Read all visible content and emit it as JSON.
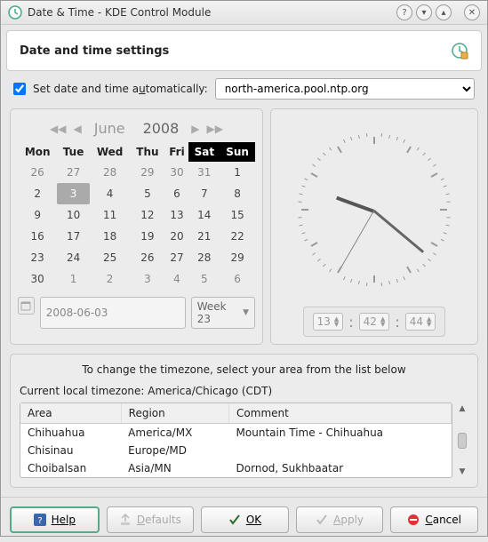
{
  "titlebar": {
    "title": "Date & Time - KDE Control Module"
  },
  "header": {
    "title": "Date and time settings"
  },
  "auto": {
    "label_pre": "Set date and time a",
    "label_u": "u",
    "label_post": "tomatically:",
    "checked": true,
    "server": "north-america.pool.ntp.org"
  },
  "calendar": {
    "month": "June",
    "year": "2008",
    "headers": [
      "Mon",
      "Tue",
      "Wed",
      "Thu",
      "Fri",
      "Sat",
      "Sun"
    ],
    "weeks": [
      [
        {
          "d": "26"
        },
        {
          "d": "27"
        },
        {
          "d": "28"
        },
        {
          "d": "29"
        },
        {
          "d": "30"
        },
        {
          "d": "31"
        },
        {
          "d": "1",
          "in": true
        }
      ],
      [
        {
          "d": "2",
          "in": true
        },
        {
          "d": "3",
          "in": true,
          "sel": true
        },
        {
          "d": "4",
          "in": true
        },
        {
          "d": "5",
          "in": true
        },
        {
          "d": "6",
          "in": true
        },
        {
          "d": "7",
          "in": true
        },
        {
          "d": "8",
          "in": true
        }
      ],
      [
        {
          "d": "9",
          "in": true
        },
        {
          "d": "10",
          "in": true
        },
        {
          "d": "11",
          "in": true
        },
        {
          "d": "12",
          "in": true
        },
        {
          "d": "13",
          "in": true
        },
        {
          "d": "14",
          "in": true
        },
        {
          "d": "15",
          "in": true
        }
      ],
      [
        {
          "d": "16",
          "in": true
        },
        {
          "d": "17",
          "in": true
        },
        {
          "d": "18",
          "in": true
        },
        {
          "d": "19",
          "in": true
        },
        {
          "d": "20",
          "in": true
        },
        {
          "d": "21",
          "in": true
        },
        {
          "d": "22",
          "in": true
        }
      ],
      [
        {
          "d": "23",
          "in": true
        },
        {
          "d": "24",
          "in": true
        },
        {
          "d": "25",
          "in": true
        },
        {
          "d": "26",
          "in": true
        },
        {
          "d": "27",
          "in": true
        },
        {
          "d": "28",
          "in": true
        },
        {
          "d": "29",
          "in": true
        }
      ],
      [
        {
          "d": "30",
          "in": true
        },
        {
          "d": "1"
        },
        {
          "d": "2"
        },
        {
          "d": "3"
        },
        {
          "d": "4"
        },
        {
          "d": "5"
        },
        {
          "d": "6"
        }
      ]
    ],
    "date_text": "2008-06-03",
    "week_text": "Week 23"
  },
  "time": {
    "h": "13",
    "m": "42",
    "s": "44"
  },
  "tz": {
    "hint": "To change the timezone, select your area from the list below",
    "current": "Current local timezone: America/Chicago (CDT)",
    "cols": [
      "Area",
      "Region",
      "Comment"
    ],
    "rows": [
      {
        "area": "Chihuahua",
        "region": "America/MX",
        "comment": "Mountain Time - Chihuahua"
      },
      {
        "area": "Chisinau",
        "region": "Europe/MD",
        "comment": ""
      },
      {
        "area": "Choibalsan",
        "region": "Asia/MN",
        "comment": "Dornod, Sukhbaatar"
      }
    ]
  },
  "buttons": {
    "help": "Help",
    "defaults": "Defaults",
    "ok": "OK",
    "apply": "Apply",
    "cancel": "Cancel"
  }
}
